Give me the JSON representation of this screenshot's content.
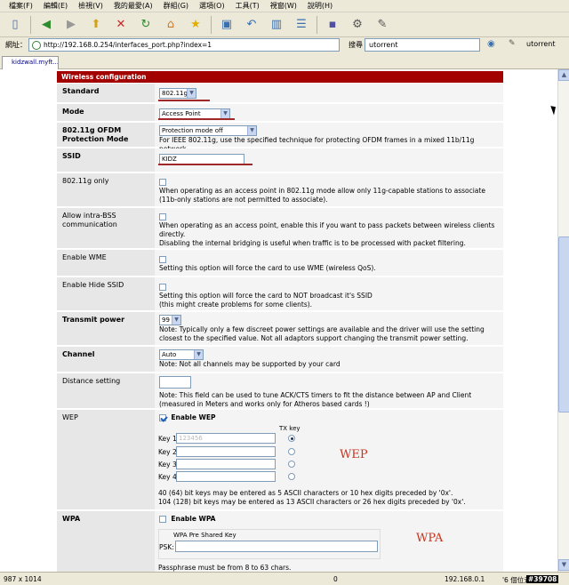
{
  "menu": [
    "檔案(F)",
    "編輯(E)",
    "檢視(V)",
    "我的最愛(A)",
    "群組(G)",
    "選項(O)",
    "工具(T)",
    "視窗(W)",
    "說明(H)"
  ],
  "address": {
    "label": "網址：",
    "url": "http://192.168.0.254/interfaces_port.php?index=1"
  },
  "search": {
    "label": "搜尋",
    "value": "utorrent",
    "button_label": "utorrent"
  },
  "tab": {
    "label": "kidzwall.myft..."
  },
  "section_title": "Wireless configuration",
  "rows": {
    "standard": {
      "label": "Standard",
      "value": "802.11g"
    },
    "mode": {
      "label": "Mode",
      "value": "Access Point"
    },
    "ofdm": {
      "label": "802.11g OFDM Protection Mode",
      "value": "Protection mode off",
      "note": "For IEEE 802.11g, use the specified technique for protecting OFDM frames in a mixed 11b/11g network."
    },
    "ssid": {
      "label": "SSID",
      "value": "KIDZ"
    },
    "only11g": {
      "label": "802.11g only",
      "note": "When operating as an access point in 802.11g mode allow only 11g-capable stations to associate (11b-only stations are not permitted to associate)."
    },
    "intrabss": {
      "label": "Allow intra-BSS communication",
      "note1": "When operating as an access point, enable this if you want to pass packets between wireless clients directly.",
      "note2": "Disabling the internal bridging is useful when traffic is to be processed with packet filtering."
    },
    "wme": {
      "label": "Enable WME",
      "note": "Setting this option will force the card to use WME (wireless QoS)."
    },
    "hidessid": {
      "label": "Enable Hide SSID",
      "note1": "Setting this option will force the card to NOT broadcast it's SSID",
      "note2": "(this might create problems for some clients)."
    },
    "txpower": {
      "label": "Transmit power",
      "value": "99",
      "note": "Note: Typically only a few discreet power settings are available and the driver will use the setting closest to the specified value. Not all adaptors support changing the transmit power setting."
    },
    "channel": {
      "label": "Channel",
      "value": "Auto",
      "note": "Note: Not all channels may be supported by your card"
    },
    "distance": {
      "label": "Distance setting",
      "value": "",
      "note1": "Note: This field can be used to tune ACK/CTS timers to fit the distance between AP and Client",
      "note2": "(measured in Meters and works only for Atheros based cards !)"
    },
    "wep": {
      "label": "WEP",
      "enable": "Enable WEP",
      "txkey": "TX key",
      "keys": [
        {
          "label": "Key 1:",
          "value": "123456"
        },
        {
          "label": "Key 2:",
          "value": ""
        },
        {
          "label": "Key 3:",
          "value": ""
        },
        {
          "label": "Key 4:",
          "value": ""
        }
      ],
      "note1": "40 (64) bit keys may be entered as 5 ASCII characters or 10 hex digits preceded by '0x'.",
      "note2": "104 (128) bit keys may be entered as 13 ASCII characters or 26 hex digits preceded by '0x'."
    },
    "wpa": {
      "label": "WPA",
      "enable": "Enable WPA",
      "psk_title": "WPA Pre Shared Key",
      "psk_label": "PSK:",
      "psk_value": "",
      "note": "Passphrase must be from 8 to 63 chars."
    }
  },
  "annotations": {
    "wep": "WEP",
    "wpa": "WPA"
  },
  "status": {
    "size": "987 x 1014",
    "zero": "0",
    "ip": "192.168.0.1",
    "locale": "'6 個位元'",
    "id": "#39708"
  },
  "colors": {
    "header": "#a30000",
    "annotation": "#c8321e"
  }
}
